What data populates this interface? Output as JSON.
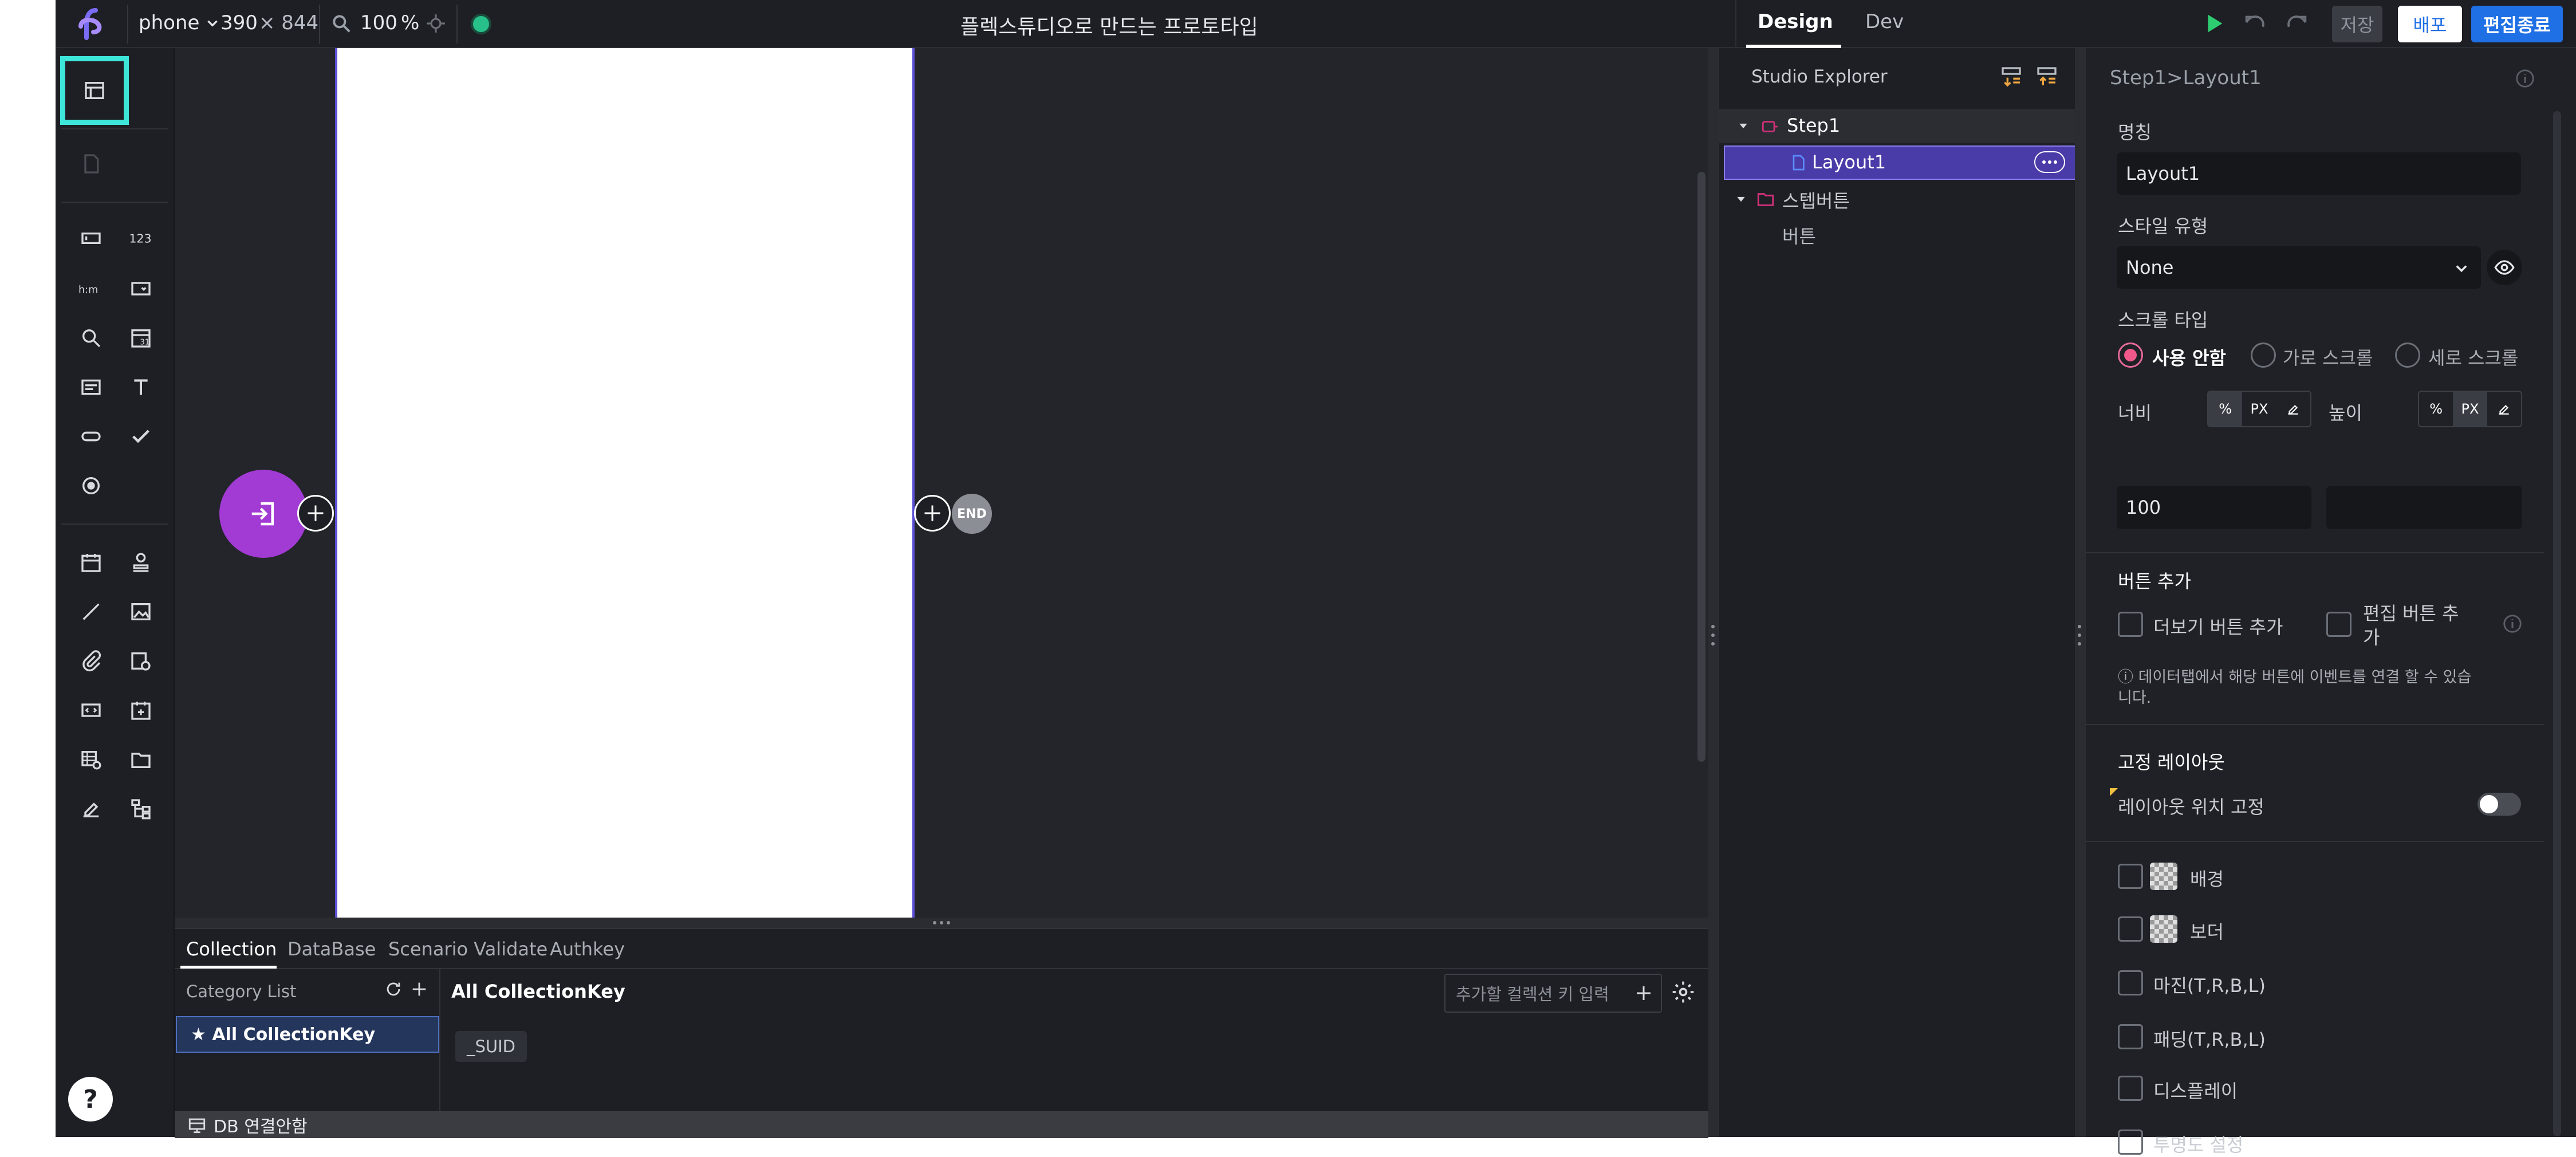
{
  "topbar": {
    "device": "phone",
    "width": "390",
    "height_label": "× 844",
    "zoom": "100",
    "zoom_unit": "%",
    "title": "플렉스튜디오로 만드는 프로토타입",
    "tabs": [
      "Design",
      "Dev"
    ],
    "save_label": "저장",
    "deploy_label": "배포",
    "finish_label": "편집종료"
  },
  "flow": {
    "end_label": "END"
  },
  "bottom": {
    "tabs": [
      "Collection",
      "DataBase",
      "Scenario Validate",
      "Authkey"
    ],
    "category_title": "Category List",
    "category_item": "★ All CollectionKey",
    "main_title": "All CollectionKey",
    "key_input_placeholder": "추가할 컬렉션 키 입력",
    "chip": "_SUID",
    "status": "DB 연결안함"
  },
  "explorer": {
    "title": "Studio Explorer",
    "tree": [
      {
        "label": "Step1"
      },
      {
        "label": "Layout1"
      },
      {
        "label": "스텝버튼"
      },
      {
        "label": "버튼"
      }
    ]
  },
  "props": {
    "breadcrumb": "Step1>Layout1",
    "name_label": "명칭",
    "name_value": "Layout1",
    "style_label": "스타일 유형",
    "style_value": "None",
    "scroll_label": "스크롤 타입",
    "scroll_options": [
      "사용 안함",
      "가로 스크롤",
      "세로 스크롤"
    ],
    "width_label": "너비",
    "height_label": "높이",
    "unit_percent": "%",
    "unit_px": "PX",
    "width_value": "100",
    "add_button_section": "버튼 추가",
    "more_button": "더보기 버튼 추가",
    "edit_button_line1": "편집 버튼 추",
    "edit_button_line2": "가",
    "note_line1": "ⓘ 데이터탭에서 해당 버튼에 이벤트를 연결 할 수 있습",
    "note_line2": "니다.",
    "fixed_layout_section": "고정 레이아웃",
    "fix_position_label": "레이아웃 위치 고정",
    "options": [
      "배경",
      "보더",
      "마진(T,R,B,L)",
      "패딩(T,R,B,L)",
      "디스플레이",
      "투명도 설정"
    ]
  },
  "colors": {
    "accent_purple": "#a23ad4",
    "selected_row": "#4a3ca8",
    "teal_highlight": "#3ee6d9",
    "blue_button": "#1f6fe5",
    "status_green": "#27c08a"
  }
}
